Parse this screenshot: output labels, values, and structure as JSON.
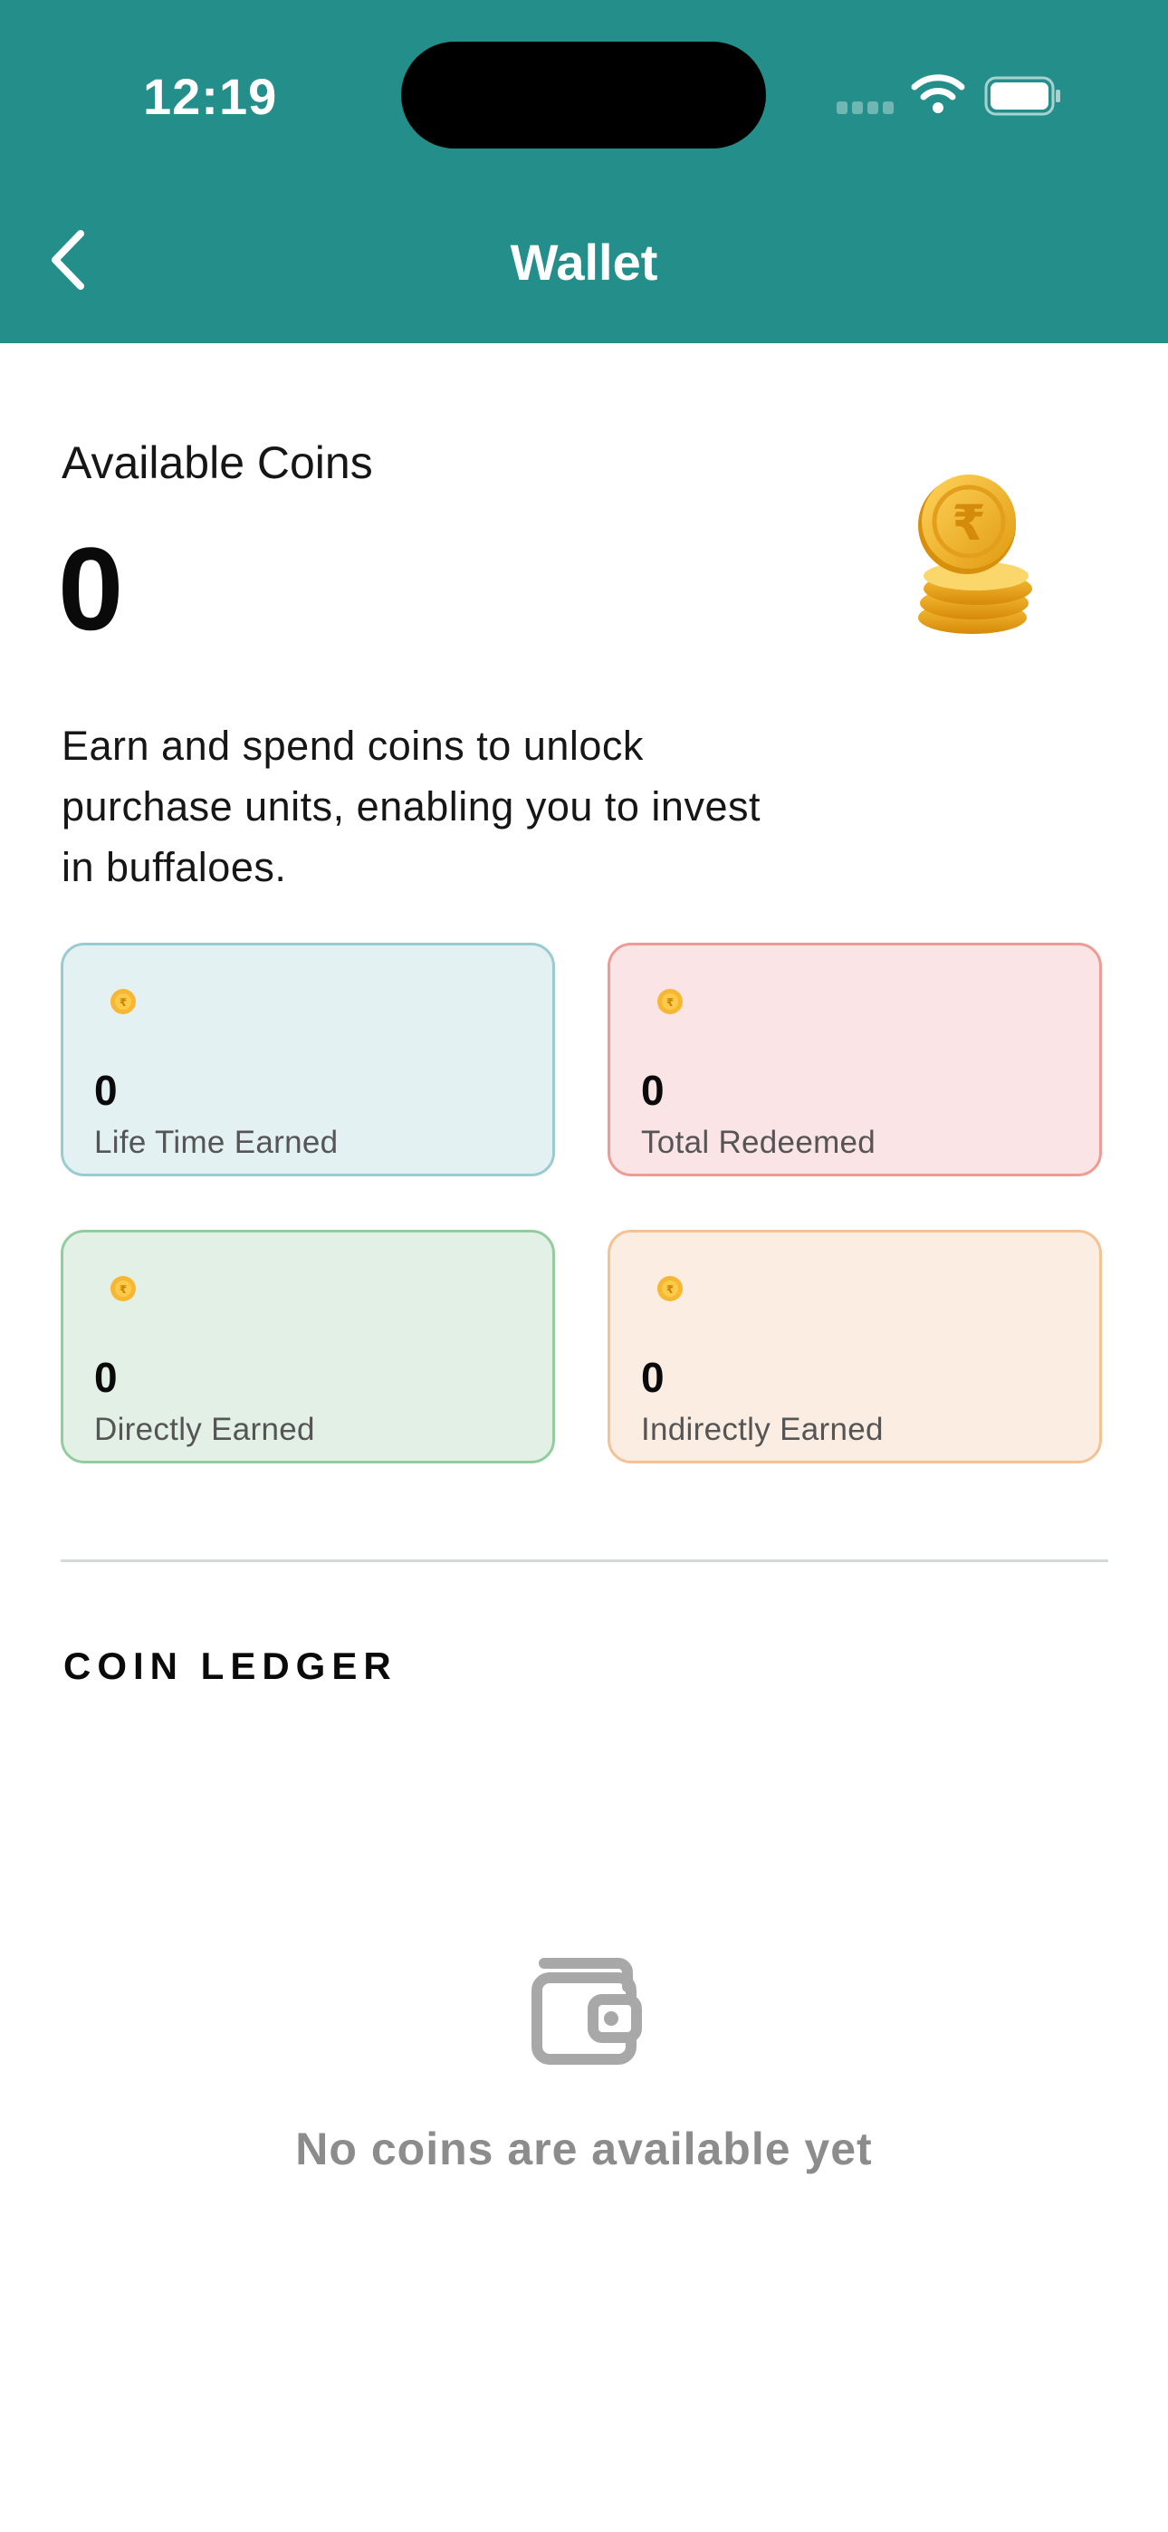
{
  "status_bar": {
    "time": "12:19"
  },
  "header": {
    "title": "Wallet",
    "back_icon": "chevron-left-icon",
    "color": "#248F8A"
  },
  "wallet": {
    "available_label": "Available Coins",
    "available_value": "0",
    "coin_icon": "coin-stack-icon",
    "description_lines": [
      "Earn and spend coins to unlock",
      "purchase units, enabling you to invest",
      "in buffaloes."
    ]
  },
  "stats": [
    {
      "value": "0",
      "label": "Life Time Earned",
      "bg": "#E4F1F2",
      "border": "#9ACBD1"
    },
    {
      "value": "0",
      "label": "Total Redeemed",
      "bg": "#FAE4E6",
      "border": "#EE9A95"
    },
    {
      "value": "0",
      "label": "Directly Earned",
      "bg": "#E2F0E6",
      "border": "#93CC9E"
    },
    {
      "value": "0",
      "label": "Indirectly Earned",
      "bg": "#FBEDE2",
      "border": "#F5C195"
    }
  ],
  "ledger": {
    "title": "COIN LEDGER",
    "empty_icon": "wallet-icon",
    "empty_message": "No coins are available yet"
  }
}
